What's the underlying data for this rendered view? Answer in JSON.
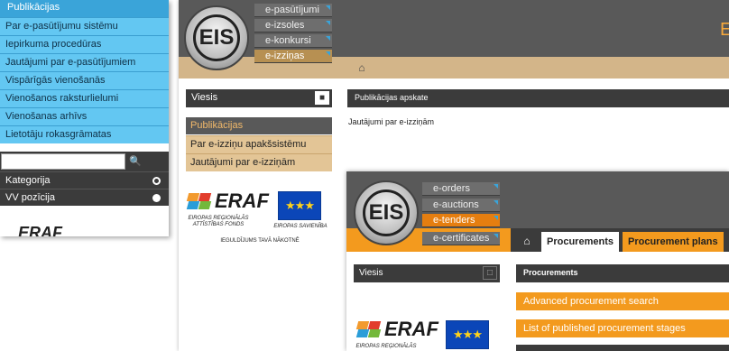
{
  "shot1": {
    "header": "Publikācijas",
    "menu_items": [
      "Par e-pasūtījumu sistēmu",
      "Iepirkuma procedūras",
      "Jautājumi par e-pasūtījumiem",
      "Vispārīgās vienošanās",
      "Vienošanos raksturlielumi",
      "Vienošanas arhīvs",
      "Lietotāju rokasgrāmatas"
    ],
    "search_value": "",
    "rows": [
      "Kategorija",
      "VV pozīcija"
    ],
    "logo_text": "ERAF"
  },
  "shot2": {
    "logo_text": "EIS",
    "tabs": [
      "e-pasūtījumi",
      "e-izsoles",
      "e-konkursi",
      "e-izziņas"
    ],
    "heading_fragment": "E",
    "viesis_label": "Viesis",
    "sidebar_header": "Publikācijas",
    "sidebar_items": [
      "Par e-izziņu apakšsistēmu",
      "Jautājumi par e-izziņām"
    ],
    "main_header": "Publikācijas apskate",
    "main_text": "Jautājumi par e-izziņām",
    "eraf_text": "ERAF",
    "eraf_caption_1": "EIROPAS REĢIONĀLĀS",
    "eraf_caption_2": "ATTĪSTĪBAS FONDS",
    "eu_caption": "EIROPAS SAVIENĪBA",
    "slogan": "IEGULDĪJUMS TAVĀ NĀKOTNĒ"
  },
  "shot3": {
    "logo_text": "EIS",
    "tabs": [
      "e-orders",
      "e-auctions",
      "e-tenders",
      "e-certificates"
    ],
    "nav_tabs": [
      "Procurements",
      "Procurement plans"
    ],
    "viesis_label": "Viesis",
    "main_header": "Procurements",
    "links": [
      "Advanced procurement search",
      "List of published procurement stages"
    ],
    "eraf_text": "ERAF",
    "eraf_caption_1": "EIROPAS REĢIONĀLĀS"
  },
  "colors": {
    "blue_header": "#3aa4d9",
    "blue_item": "#63c7f2",
    "dark": "#3b3b3b",
    "tan": "#d3b589",
    "tan_item": "#e3c596",
    "orange": "#f39a1e"
  }
}
